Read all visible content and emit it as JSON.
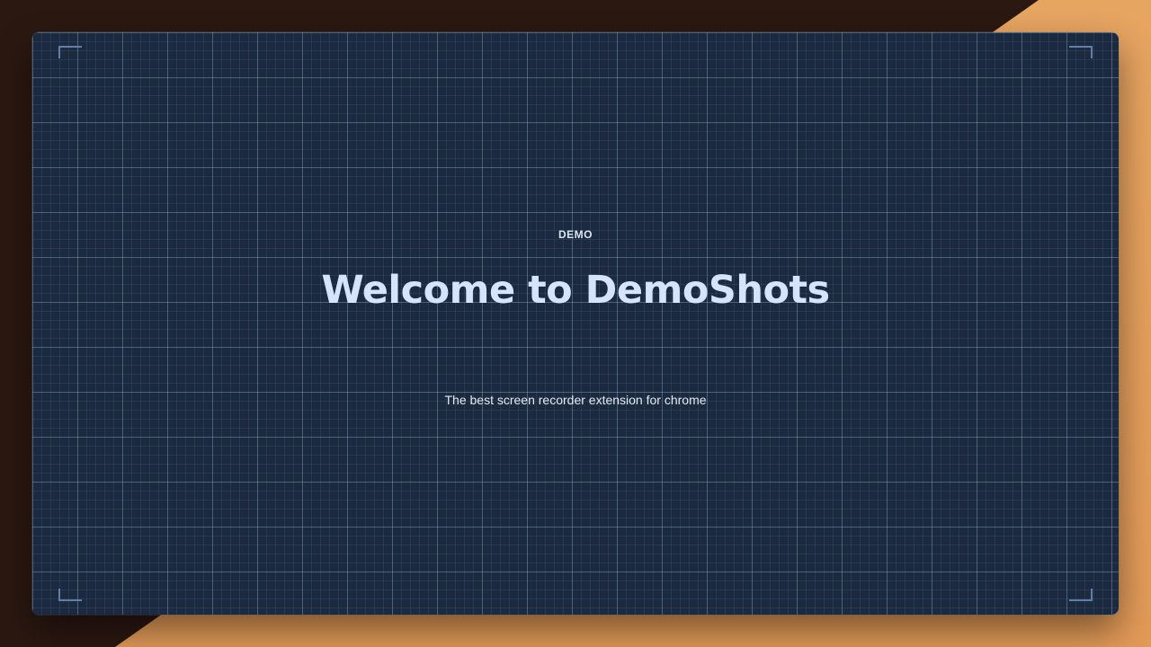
{
  "hero": {
    "eyebrow": "DEMO",
    "title": "Welcome to DemoShots",
    "subtitle": "The best screen recorder extension for chrome"
  },
  "colors": {
    "background_dark": "#2b1811",
    "background_accent": "#e7a562",
    "card_background": "#1b2a3f",
    "title_color": "#d5e4fb",
    "corner_marks": "#5f7fa8"
  }
}
